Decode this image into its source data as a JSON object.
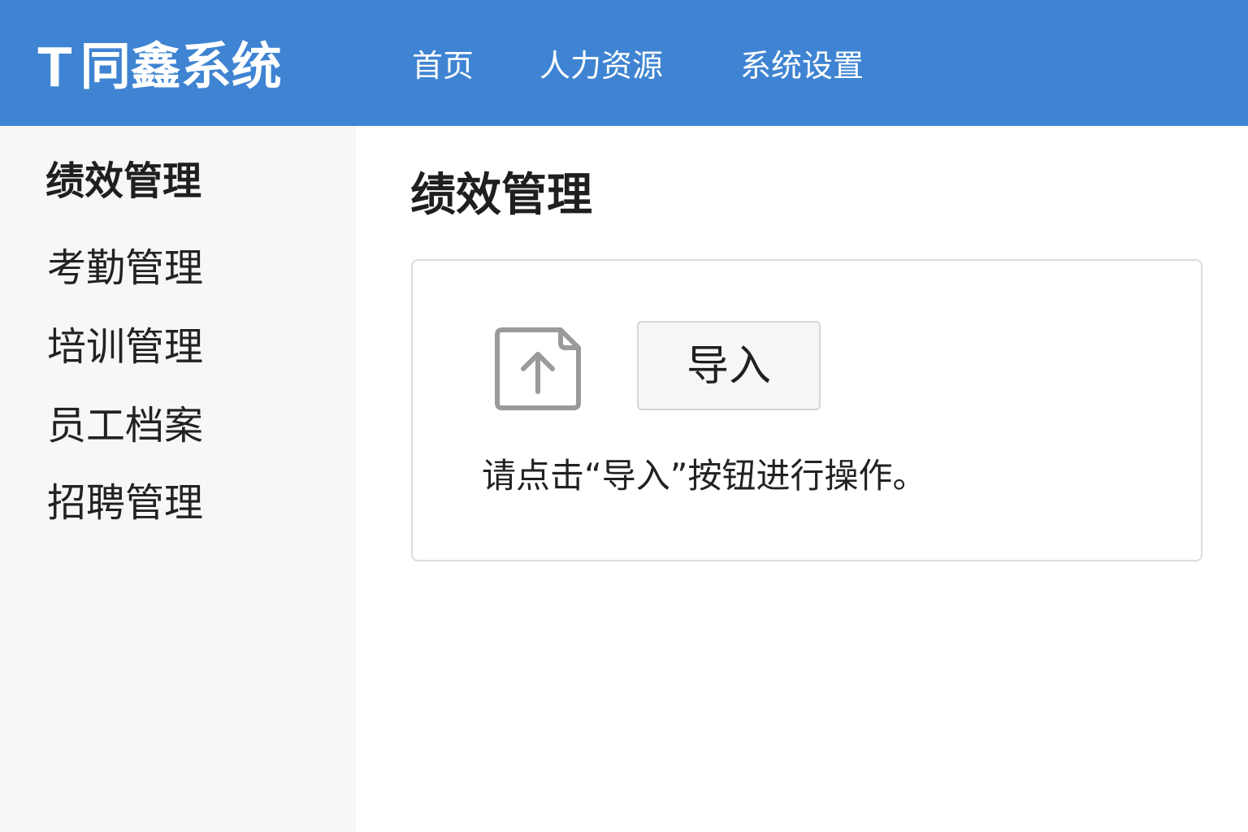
{
  "header": {
    "logo_mark": "T",
    "app_name": "同鑫系统",
    "nav": [
      {
        "label": "首页"
      },
      {
        "label": "人力资源"
      },
      {
        "label": "系统设置"
      }
    ],
    "background_color": "#3f84d2"
  },
  "sidebar": {
    "title": "绩效管理",
    "items": [
      {
        "label": "考勤管理"
      },
      {
        "label": "培训管理"
      },
      {
        "label": "员工档案"
      },
      {
        "label": "招聘管理"
      }
    ],
    "background_color": "#f7f7f7"
  },
  "main": {
    "title": "绩效管理",
    "import_icon": "upload-file-icon",
    "import_button_label": "导入",
    "hint_text": "请点击“导入”按钮进行操作。"
  }
}
